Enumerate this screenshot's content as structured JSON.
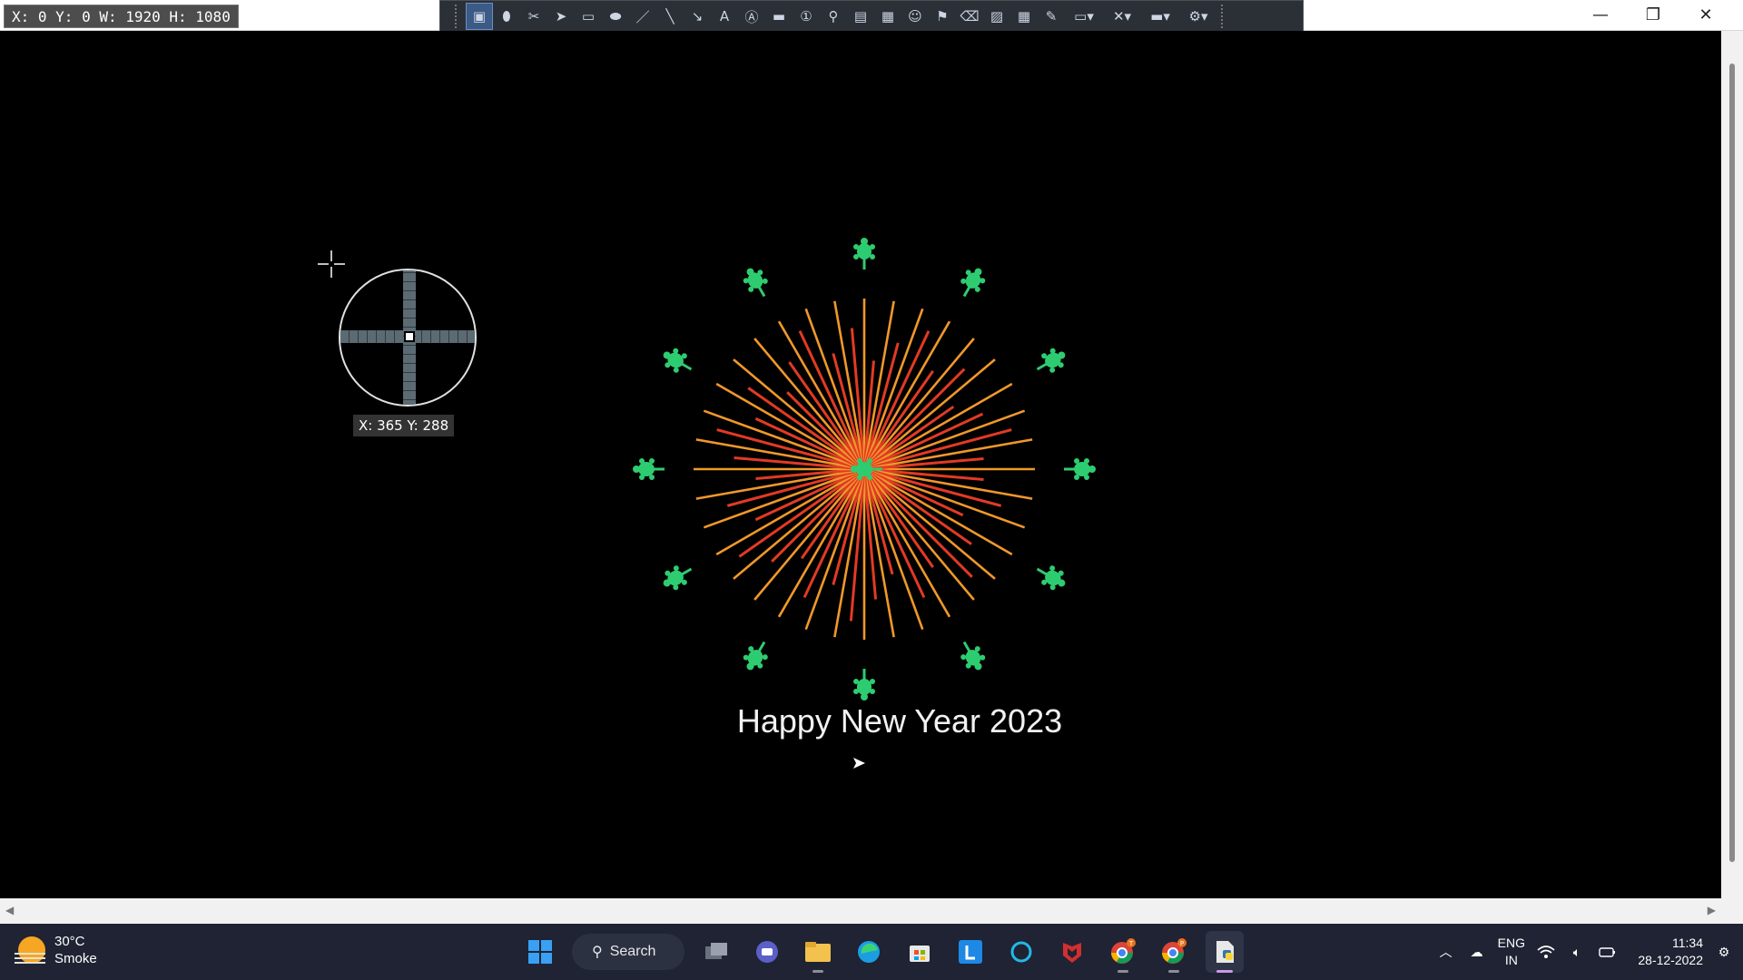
{
  "overlay": {
    "dimensions": "X: 0 Y: 0 W: 1920 H: 1080",
    "cursor_coords": "X: 365 Y: 288"
  },
  "toolbar": {
    "tools": [
      "capture-region-icon",
      "capture-ellipse-icon",
      "capture-freehand-icon",
      "select-arrow-icon",
      "rectangle-icon",
      "ellipse-icon",
      "pen-icon",
      "line-icon",
      "arrow-icon",
      "text-icon",
      "text-box-icon",
      "speech-bubble-icon",
      "step-counter-icon",
      "magnify-icon",
      "sticky-note-icon",
      "highlight-callout-icon",
      "emoji-icon",
      "stamp-icon",
      "eraser-icon",
      "hatch-icon",
      "grid-icon",
      "marker-icon",
      "edit-menu-icon",
      "tools-menu-icon",
      "display-menu-icon",
      "settings-icon"
    ]
  },
  "window_controls": {
    "minimize": "—",
    "restore": "❐",
    "close": "✕"
  },
  "canvas": {
    "greeting": "Happy New Year 2023",
    "colors": {
      "spark_orange": "#f0982a",
      "spark_red": "#e23a24",
      "turtle_green": "#2ecc71"
    }
  },
  "taskbar": {
    "weather": {
      "temp": "30°C",
      "condition": "Smoke"
    },
    "search_label": "Search",
    "apps": [
      {
        "name": "start-button",
        "label": "Start"
      },
      {
        "name": "task-view",
        "label": "Task View"
      },
      {
        "name": "chat-app",
        "label": "Chat"
      },
      {
        "name": "file-explorer",
        "label": "File Explorer"
      },
      {
        "name": "edge-browser",
        "label": "Edge"
      },
      {
        "name": "microsoft-store",
        "label": "Store"
      },
      {
        "name": "l-app",
        "label": "L"
      },
      {
        "name": "cortana-app",
        "label": "Cortana"
      },
      {
        "name": "mcafee-app",
        "label": "McAfee"
      },
      {
        "name": "chrome-t",
        "label": "Chrome T"
      },
      {
        "name": "chrome-p",
        "label": "Chrome P"
      },
      {
        "name": "python-editor",
        "label": "Python"
      }
    ],
    "chrome_badges": {
      "t": "T",
      "p": "P"
    },
    "tray": {
      "lang_top": "ENG",
      "lang_bottom": "IN",
      "time": "11:34",
      "date": "28-12-2022"
    }
  }
}
